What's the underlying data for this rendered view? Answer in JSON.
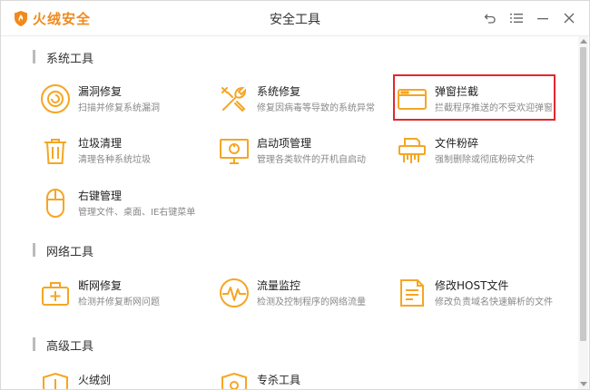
{
  "app": {
    "brand": "火绒安全",
    "title": "安全工具"
  },
  "window_controls": [
    {
      "name": "back-icon"
    },
    {
      "name": "menu-icon"
    },
    {
      "name": "minimize-icon"
    },
    {
      "name": "close-icon"
    }
  ],
  "sections": {
    "system": {
      "title": "系统工具",
      "tools": [
        {
          "name": "漏洞修复",
          "desc": "扫描并修复系统漏洞",
          "icon": "vulnerability-fix-icon"
        },
        {
          "name": "系统修复",
          "desc": "修复因病毒等导致的系统异常",
          "icon": "system-repair-icon"
        },
        {
          "name": "弹窗拦截",
          "desc": "拦截程序推送的不受欢迎弹窗",
          "icon": "popup-block-icon"
        },
        {
          "name": "垃圾清理",
          "desc": "清理各种系统垃圾",
          "icon": "trash-icon"
        },
        {
          "name": "启动项管理",
          "desc": "管理各类软件的开机自启动",
          "icon": "startup-monitor-icon"
        },
        {
          "name": "文件粉碎",
          "desc": "强制删除或彻底粉碎文件",
          "icon": "shredder-icon"
        },
        {
          "name": "右键管理",
          "desc": "管理文件、桌面、IE右键菜单",
          "icon": "mouse-icon"
        }
      ]
    },
    "network": {
      "title": "网络工具",
      "tools": [
        {
          "name": "断网修复",
          "desc": "检测并修复断网问题",
          "icon": "network-fix-icon"
        },
        {
          "name": "流量监控",
          "desc": "检测及控制程序的网络流量",
          "icon": "traffic-monitor-icon"
        },
        {
          "name": "修改HOST文件",
          "desc": "修改负责域名快速解析的文件",
          "icon": "host-file-icon"
        }
      ]
    },
    "advanced": {
      "title": "高级工具",
      "tools": [
        {
          "name": "火绒剑",
          "icon": "sword-shield-icon"
        },
        {
          "name": "专杀工具",
          "icon": "kill-tool-icon"
        }
      ]
    }
  },
  "colors": {
    "accent": "#f5a623",
    "brand": "#f08a1c",
    "highlight_border": "#e0282e"
  }
}
